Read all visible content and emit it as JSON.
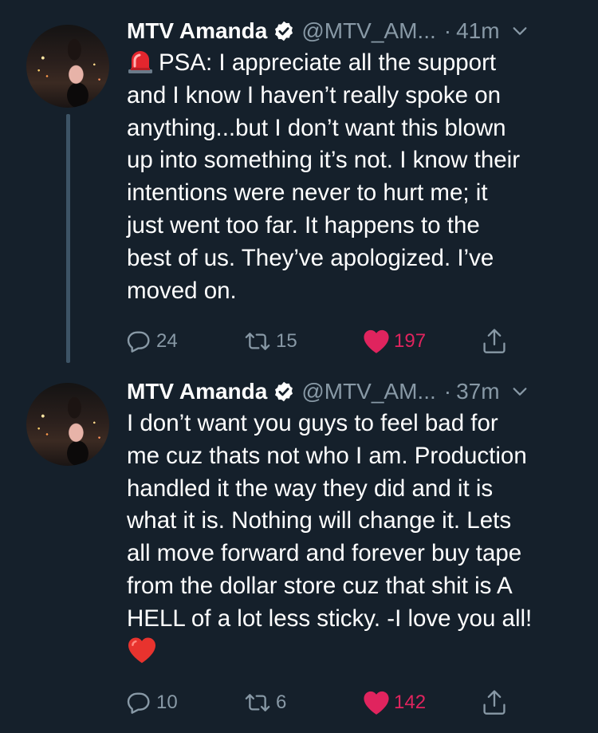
{
  "colors": {
    "background": "#15202b",
    "secondary_text": "#8899a6",
    "like_red": "#e0245e",
    "verified_badge": "#ffffff",
    "thread_line": "#3d5466"
  },
  "tweets": [
    {
      "author_name": "MTV Amanda",
      "handle": "@MTV_AM...",
      "separator": "·",
      "time": "41m",
      "lines": [
        "PSA: I appreciate all the support",
        "and I know I haven’t really spoke on",
        "anything...but I don’t want this blown",
        "up into something it’s not. I know their",
        "intentions were never to hurt me; it",
        "just went too far. It happens to the",
        "best of us. They’ve apologized. I’ve",
        "moved on."
      ],
      "leading_emoji": "police-light-emoji",
      "replies": "24",
      "retweets": "15",
      "likes": "197"
    },
    {
      "author_name": "MTV Amanda",
      "handle": "@MTV_AM...",
      "separator": "·",
      "time": "37m",
      "lines": [
        "I don’t want you guys to feel bad for",
        "me cuz thats not who I am. Production",
        "handled it the way they did and it is",
        "what it is. Nothing will change it. Lets",
        "all move forward and forever buy tape",
        "from the dollar store cuz that shit is A",
        "HELL of a lot less sticky. -I love you all!"
      ],
      "trailing_emoji": "red-heart-emoji",
      "replies": "10",
      "retweets": "6",
      "likes": "142"
    }
  ]
}
